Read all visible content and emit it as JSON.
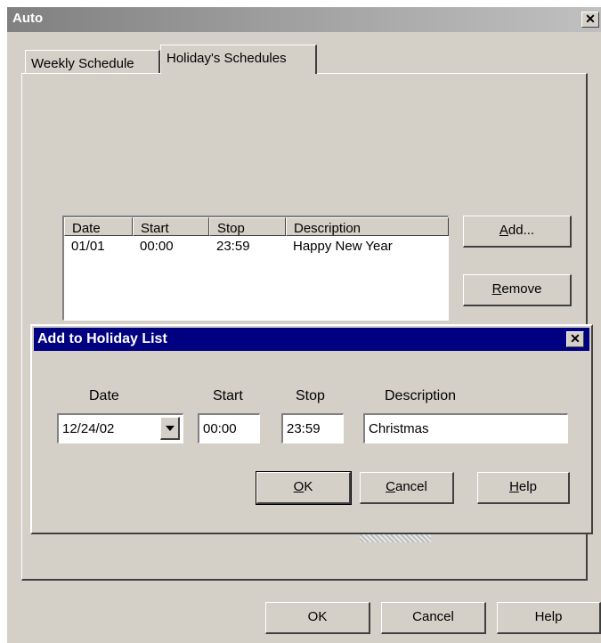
{
  "window": {
    "title": "Auto",
    "close_glyph": "✕"
  },
  "tabs": [
    {
      "label": "Weekly Schedule"
    },
    {
      "label": "Holiday's Schedules"
    }
  ],
  "holiday_list": {
    "columns": [
      "Date",
      "Start",
      "Stop",
      "Description"
    ],
    "rows": [
      {
        "date": "01/01",
        "start": "00:00",
        "stop": "23:59",
        "description": "Happy New Year"
      }
    ]
  },
  "side_buttons": {
    "add": {
      "mnemonic": "A",
      "rest": "dd..."
    },
    "remove": {
      "mnemonic": "R",
      "rest": "emove"
    }
  },
  "dialog": {
    "title": "Add to Holiday List",
    "close_glyph": "✕",
    "labels": {
      "date": "Date",
      "start": "Start",
      "stop": "Stop",
      "description": "Description"
    },
    "values": {
      "date": "12/24/02",
      "start": "00:00",
      "stop": "23:59",
      "description": "Christmas"
    },
    "buttons": {
      "ok": {
        "mnemonic": "O",
        "rest": "K"
      },
      "cancel": {
        "mnemonic": "C",
        "rest": "ancel"
      },
      "help": {
        "mnemonic": "H",
        "rest": "elp"
      }
    }
  },
  "footer": {
    "ok": "OK",
    "cancel": "Cancel",
    "help": "Help"
  },
  "colors": {
    "face": "#d4d0c8",
    "active_title": "#000080",
    "inactive_title": "#808080"
  }
}
